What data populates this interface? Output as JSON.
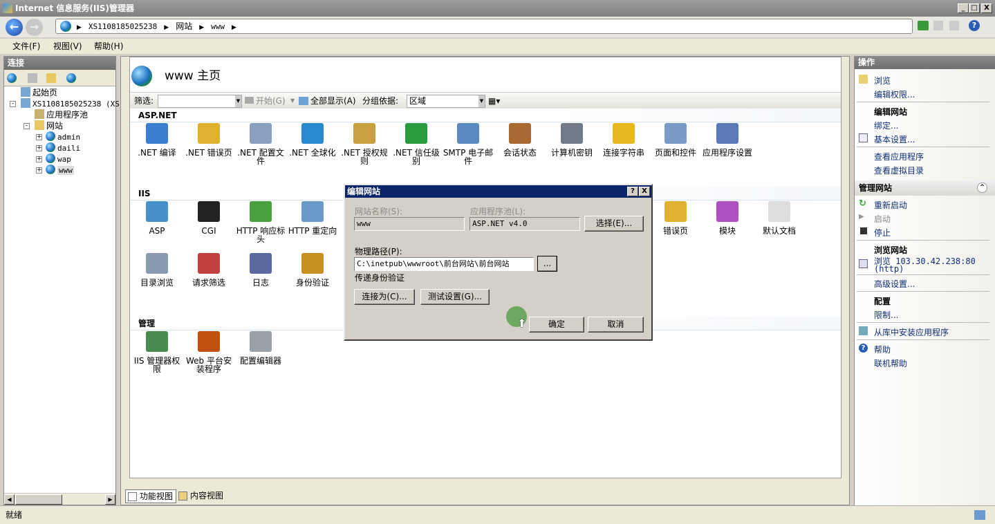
{
  "window": {
    "title": "Internet 信息服务(IIS)管理器",
    "controls": [
      "_",
      "□",
      "X"
    ]
  },
  "address": {
    "crumbs": [
      "XS1108185025238",
      "网站",
      "www"
    ]
  },
  "menu": [
    "文件(F)",
    "视图(V)",
    "帮助(H)"
  ],
  "connections": {
    "header": "连接",
    "tree": [
      {
        "label": "起始页"
      },
      {
        "label": "XS1108185025238 (XS1"
      },
      {
        "label": "应用程序池"
      },
      {
        "label": "网站"
      },
      {
        "label": "admin"
      },
      {
        "label": "daili"
      },
      {
        "label": "wap"
      },
      {
        "label": "www",
        "selected": true
      }
    ]
  },
  "main": {
    "title": "www 主页",
    "filter": {
      "label": "筛选:",
      "value": "",
      "start": "开始(G)",
      "show_all": "全部显示(A)",
      "group_by_label": "分组依据:",
      "group_by_value": "区域"
    },
    "sections": [
      {
        "name": "ASP.NET",
        "items": [
          ".NET 编译",
          ".NET 错误页",
          ".NET 配置文件",
          ".NET 全球化",
          ".NET 授权规则",
          ".NET 信任级别",
          "SMTP 电子邮件",
          "会话状态",
          "计算机密钥",
          "连接字符串",
          "页面和控件",
          "应用程序设置"
        ]
      },
      {
        "name": "IIS",
        "items": [
          "ASP",
          "CGI",
          "HTTP 响应标头",
          "HTTP 重定向",
          "错误页",
          "模块",
          "默认文档",
          "目录浏览",
          "请求筛选",
          "日志",
          "身份验证"
        ]
      },
      {
        "name": "管理",
        "items": [
          "IIS 管理器权限",
          "Web 平台安装程序",
          "配置编辑器"
        ]
      }
    ],
    "tabs": [
      "功能视图",
      "内容视图"
    ],
    "active_tab": "功能视图"
  },
  "actions": {
    "header": "操作",
    "browse": "浏览",
    "edit_permissions": "编辑权限...",
    "edit_site_header": "编辑网站",
    "bindings": "绑定...",
    "basic_settings": "基本设置...",
    "view_apps": "查看应用程序",
    "view_vdirs": "查看虚拟目录",
    "manage_header": "管理网站",
    "restart": "重新启动",
    "start": "启动",
    "stop": "停止",
    "browse_site_header": "浏览网站",
    "browse_address": "浏览 103.30.42.238:80",
    "browse_protocol": "(http)",
    "advanced": "高级设置...",
    "config_header": "配置",
    "limits": "限制...",
    "install_from_gallery": "从库中安装应用程序",
    "help": "帮助",
    "online_help": "联机帮助"
  },
  "status": {
    "text": "就绪"
  },
  "dialog": {
    "title": "编辑网站",
    "site_name_label": "网站名称(S):",
    "site_name": "www",
    "app_pool_label": "应用程序池(L):",
    "app_pool": "ASP.NET v4.0",
    "select_button": "选择(E)...",
    "physical_path_label": "物理路径(P):",
    "physical_path": "C:\\inetpub\\wwwroot\\前台网站\\前台网站",
    "browse_button": "...",
    "pass_through_label": "传递身份验证",
    "connect_as_button": "连接为(C)...",
    "test_settings_button": "测试设置(G)...",
    "ok_button": "确定",
    "cancel_button": "取消",
    "help_icon": "?",
    "close_icon": "X"
  }
}
